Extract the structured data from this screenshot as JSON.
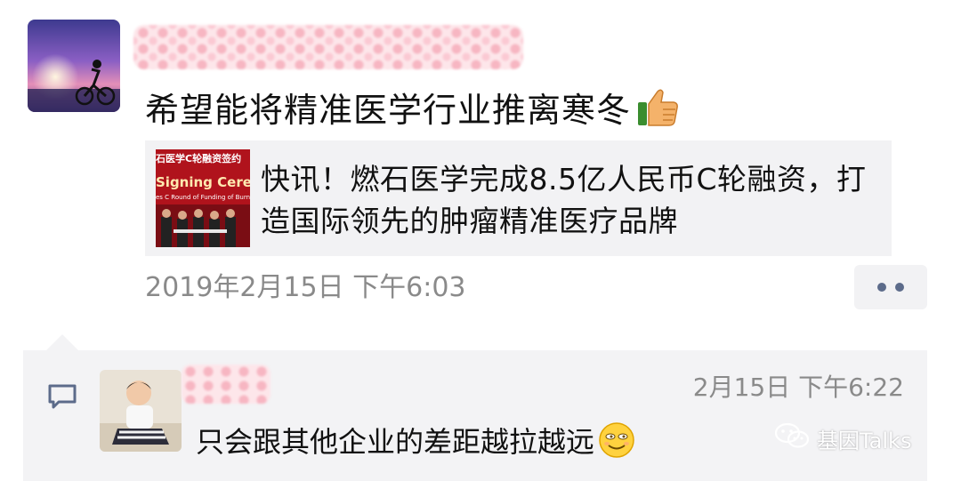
{
  "post": {
    "author_avatar_icon": "cyclist-sunset-avatar",
    "text": "希望能将精准医学行业推离寒冬",
    "text_emoji_icon": "thumbs-up-icon",
    "link": {
      "thumb_top_text": "石医学C轮融资签约",
      "thumb_mid_text": "Signing Ceremo",
      "thumb_sub_text": "es C Round of Funding of Burni",
      "title": "快讯！燃石医学完成8.5亿人民币C轮融资，打造国际领先的肿瘤精准医疗品牌"
    },
    "time": "2019年2月15日 下午6:03",
    "more_icon": "more-dots-icon"
  },
  "comment": {
    "icon": "comment-bubble-icon",
    "avatar_icon": "child-avatar",
    "time": "2月15日 下午6:22",
    "text": "只会跟其他企业的差距越拉越远",
    "text_emoji_icon": "smirk-face-icon"
  },
  "watermark": {
    "icon": "wechat-icon",
    "text": "基因Talks"
  },
  "colors": {
    "card_bg": "#f2f2f4",
    "comment_bg": "#f3f3f5",
    "meta_text": "#8a8a8a",
    "dots": "#5c6b8a",
    "link_thumb_red": "#b0131c"
  }
}
